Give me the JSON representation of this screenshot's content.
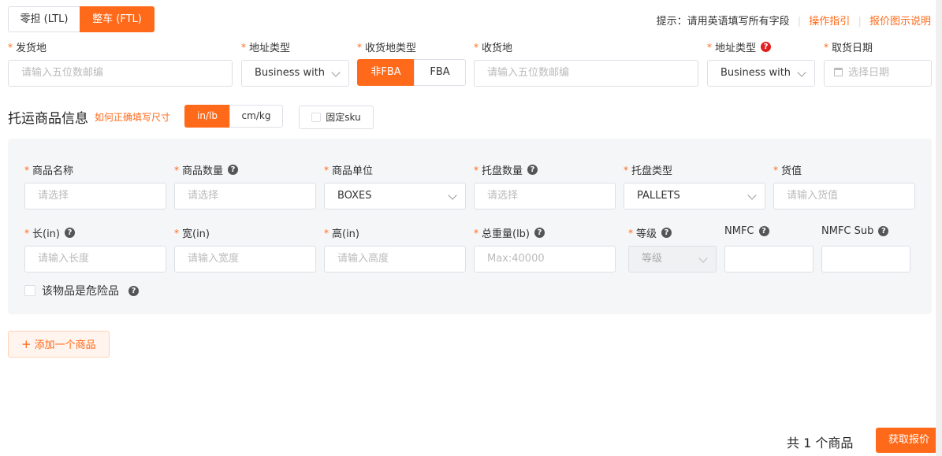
{
  "tabs": [
    {
      "label": "零担 (LTL)",
      "active": false
    },
    {
      "label": "整车 (FTL)",
      "active": true
    }
  ],
  "hint": {
    "text": "提示：请用英语填写所有字段",
    "guide_link": "操作指引",
    "quote_link": "报价图示说明"
  },
  "shipment": {
    "origin_label": "发货地",
    "origin_placeholder": "请输入五位数邮编",
    "origin_addr_type_label": "地址类型",
    "origin_addr_type_value": "Business with",
    "dest_type_label": "收货地类型",
    "dest_type_options": [
      "非FBA",
      "FBA"
    ],
    "dest_label": "收货地",
    "dest_placeholder": "请输入五位数邮编",
    "dest_addr_type_label": "地址类型",
    "dest_addr_type_value": "Business with",
    "pickup_date_label": "取货日期",
    "pickup_date_placeholder": "选择日期"
  },
  "cargo": {
    "title": "托运商品信息",
    "size_help_link": "如何正确填写尺寸",
    "units": [
      "in/lb",
      "cm/kg"
    ],
    "fixed_sku_label": "固定sku"
  },
  "item": {
    "name_label": "商品名称",
    "name_placeholder": "请选择",
    "qty_label": "商品数量",
    "qty_placeholder": "请选择",
    "unit_label": "商品单位",
    "unit_value": "BOXES",
    "pallet_qty_label": "托盘数量",
    "pallet_qty_placeholder": "请选择",
    "pallet_type_label": "托盘类型",
    "pallet_type_value": "PALLETS",
    "value_label": "货值",
    "value_placeholder": "请输入货值",
    "length_label": "长(in)",
    "length_placeholder": "请输入长度",
    "width_label": "宽(in)",
    "width_placeholder": "请输入宽度",
    "height_label": "高(in)",
    "height_placeholder": "请输入高度",
    "weight_label": "总重量(lb)",
    "weight_placeholder": "Max:40000",
    "grade_label": "等级",
    "grade_placeholder": "等级",
    "nmfc_label": "NMFC",
    "nmfc_sub_label": "NMFC Sub",
    "dangerous_label": "该物品是危险品"
  },
  "add_item_label": "添加一个商品",
  "footer": {
    "count_text": "共 1 个商品",
    "get_quote_label": "获取报价"
  },
  "colors": {
    "accent": "#ff6a1a",
    "panel_bg": "#f5f6f8"
  }
}
